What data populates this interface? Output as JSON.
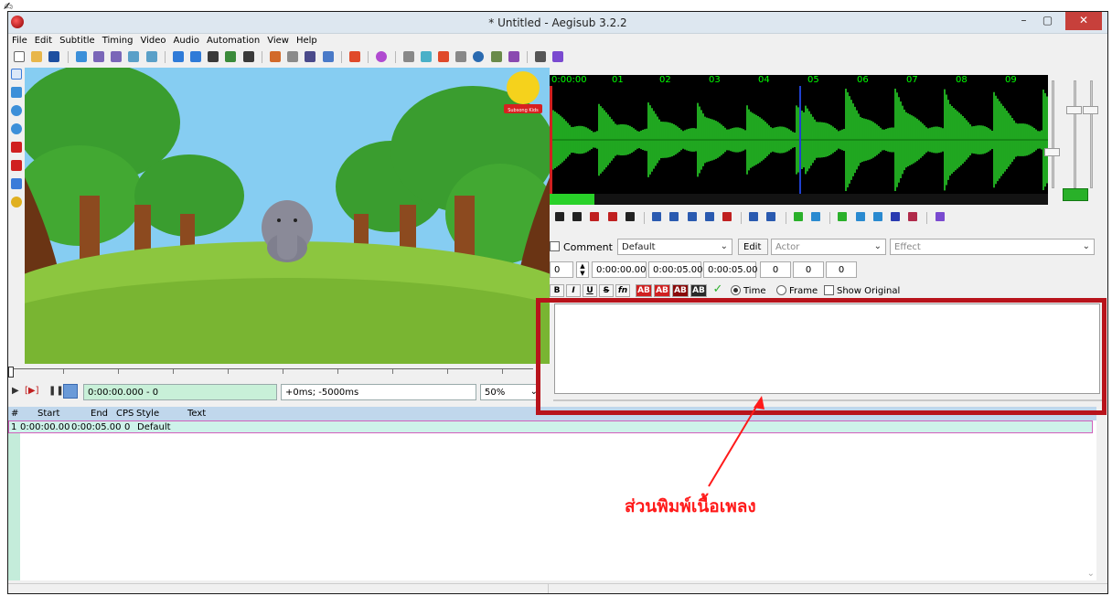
{
  "window": {
    "title": "* Untitled - Aegisub 3.2.2",
    "controls": {
      "minimize": "–",
      "maximize": "▢",
      "close": "✕"
    }
  },
  "menu": [
    "File",
    "Edit",
    "Subtitle",
    "Timing",
    "Video",
    "Audio",
    "Automation",
    "View",
    "Help"
  ],
  "video_controls": {
    "time": "0:00:00.000 - 0",
    "offset": "+0ms; -5000ms",
    "zoom": "50%"
  },
  "audio": {
    "ruler": [
      "0:00:00",
      "01",
      "02",
      "03",
      "04",
      "05",
      "06",
      "07",
      "08",
      "09"
    ],
    "playback_fraction": 0.09
  },
  "editbox": {
    "comment_label": "Comment",
    "style": "Default",
    "edit_button": "Edit",
    "actor_placeholder": "Actor",
    "effect_placeholder": "Effect",
    "line_number": "0",
    "layer": "0",
    "start_time": "0:00:00.00",
    "end_time": "0:00:05.00",
    "duration": "0:00:05.00",
    "margin_l": "0",
    "margin_r": "0",
    "margin_v": "0",
    "format_buttons": [
      "B",
      "I",
      "U",
      "S",
      "fn",
      "AB",
      "AB",
      "AB",
      "AB"
    ],
    "time_label": "Time",
    "frame_label": "Frame",
    "show_original_label": "Show Original",
    "text": ""
  },
  "grid": {
    "headers": [
      "#",
      "Start",
      "End",
      "CPS",
      "Style",
      "Text"
    ],
    "rows": [
      {
        "num": "1",
        "start": "0:00:00.00",
        "end": "0:00:05.00",
        "cps": "0",
        "style": "Default",
        "text": ""
      }
    ]
  },
  "annotation": {
    "label": "ส่วนพิมพ์เนื้อเพลง",
    "color": "#ff1a1a"
  },
  "colors": {
    "waveform": "#29d129",
    "highlight_box": "#b8131b",
    "grid_header": "#c0d7ec",
    "selected_row": "#cef2ea"
  },
  "video_logo_text": "Subsong Kids"
}
